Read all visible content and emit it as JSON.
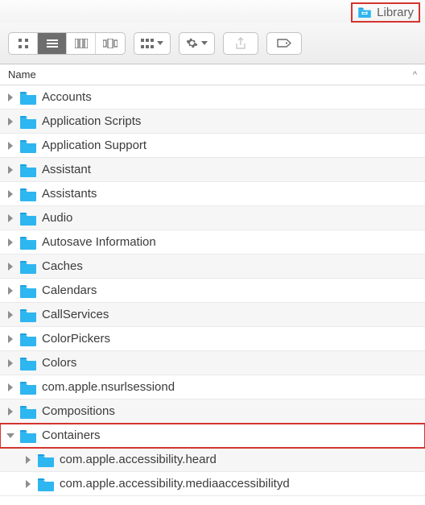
{
  "title": {
    "folder_icon": "library-folder-icon",
    "label": "Library"
  },
  "toolbar": {
    "view_icon": "icon-view",
    "view_list": "list-view",
    "view_column": "column-view",
    "view_cover": "coverflow-view",
    "arrange": "arrange",
    "action": "action",
    "share": "share",
    "tags": "tags"
  },
  "header": {
    "name_col": "Name",
    "sort_indicator": "^"
  },
  "colors": {
    "folder": "#2EB6F0",
    "highlight": "#d4342f"
  },
  "items": [
    {
      "name": "Accounts",
      "expanded": false,
      "depth": 0,
      "highlight": false
    },
    {
      "name": "Application Scripts",
      "expanded": false,
      "depth": 0,
      "highlight": false
    },
    {
      "name": "Application Support",
      "expanded": false,
      "depth": 0,
      "highlight": false
    },
    {
      "name": "Assistant",
      "expanded": false,
      "depth": 0,
      "highlight": false
    },
    {
      "name": "Assistants",
      "expanded": false,
      "depth": 0,
      "highlight": false
    },
    {
      "name": "Audio",
      "expanded": false,
      "depth": 0,
      "highlight": false
    },
    {
      "name": "Autosave Information",
      "expanded": false,
      "depth": 0,
      "highlight": false
    },
    {
      "name": "Caches",
      "expanded": false,
      "depth": 0,
      "highlight": false
    },
    {
      "name": "Calendars",
      "expanded": false,
      "depth": 0,
      "highlight": false
    },
    {
      "name": "CallServices",
      "expanded": false,
      "depth": 0,
      "highlight": false
    },
    {
      "name": "ColorPickers",
      "expanded": false,
      "depth": 0,
      "highlight": false
    },
    {
      "name": "Colors",
      "expanded": false,
      "depth": 0,
      "highlight": false
    },
    {
      "name": "com.apple.nsurlsessiond",
      "expanded": false,
      "depth": 0,
      "highlight": false
    },
    {
      "name": "Compositions",
      "expanded": false,
      "depth": 0,
      "highlight": false
    },
    {
      "name": "Containers",
      "expanded": true,
      "depth": 0,
      "highlight": true
    },
    {
      "name": "com.apple.accessibility.heard",
      "expanded": false,
      "depth": 1,
      "highlight": false
    },
    {
      "name": "com.apple.accessibility.mediaaccessibilityd",
      "expanded": false,
      "depth": 1,
      "highlight": false
    }
  ]
}
